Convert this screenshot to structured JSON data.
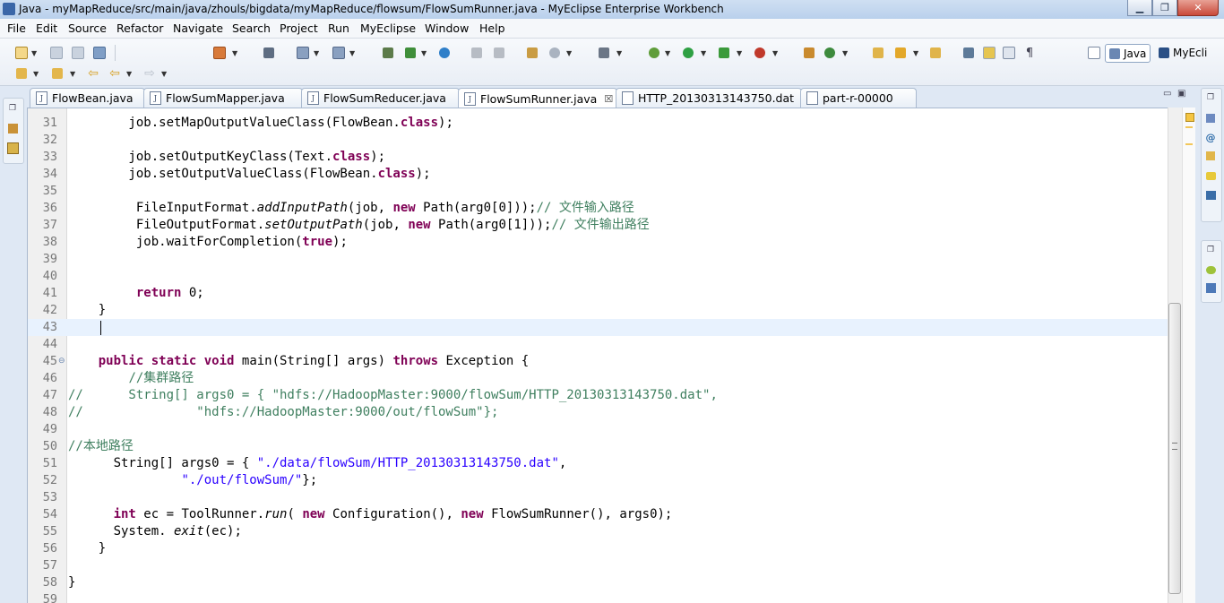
{
  "window": {
    "title": "Java - myMapReduce/src/main/java/zhouls/bigdata/myMapReduce/flowsum/FlowSumRunner.java - MyEclipse Enterprise Workbench",
    "min_glyph": "▁",
    "max_glyph": "❐",
    "close_glyph": "✕"
  },
  "menu": [
    "File",
    "Edit",
    "Source",
    "Refactor",
    "Navigate",
    "Search",
    "Project",
    "Run",
    "MyEclipse",
    "Window",
    "Help"
  ],
  "perspectives": {
    "java": "Java",
    "myeclipse": "MyEcli"
  },
  "tabs": [
    {
      "label": "FlowBean.java",
      "active": false
    },
    {
      "label": "FlowSumMapper.java",
      "active": false
    },
    {
      "label": "FlowSumReducer.java",
      "active": false
    },
    {
      "label": "FlowSumRunner.java",
      "active": true,
      "close": "☒"
    },
    {
      "label": "HTTP_20130313143750.dat",
      "active": false
    },
    {
      "label": "part-r-00000",
      "active": false
    }
  ],
  "tab_controls": {
    "minimize": "▭",
    "maximize": "▣"
  },
  "editor": {
    "current_line": 43,
    "lines": [
      {
        "n": "31",
        "tokens": [
          {
            "t": "        job.setMapOutputValueClass(FlowBean."
          },
          {
            "t": "class",
            "c": "k"
          },
          {
            "t": ");"
          }
        ]
      },
      {
        "n": "32",
        "tokens": []
      },
      {
        "n": "33",
        "tokens": [
          {
            "t": "        job.setOutputKeyClass(Text."
          },
          {
            "t": "class",
            "c": "k"
          },
          {
            "t": ");"
          }
        ]
      },
      {
        "n": "34",
        "tokens": [
          {
            "t": "        job.setOutputValueClass(FlowBean."
          },
          {
            "t": "class",
            "c": "k"
          },
          {
            "t": ");"
          }
        ]
      },
      {
        "n": "35",
        "tokens": []
      },
      {
        "n": "36",
        "tokens": [
          {
            "t": "         FileInputFormat."
          },
          {
            "t": "addInputPath",
            "c": "i"
          },
          {
            "t": "(job, "
          },
          {
            "t": "new",
            "c": "k"
          },
          {
            "t": " Path(arg0[0]));"
          },
          {
            "t": "// 文件输入路径",
            "c": "c"
          }
        ]
      },
      {
        "n": "37",
        "tokens": [
          {
            "t": "         FileOutputFormat."
          },
          {
            "t": "setOutputPath",
            "c": "i"
          },
          {
            "t": "(job, "
          },
          {
            "t": "new",
            "c": "k"
          },
          {
            "t": " Path(arg0[1]));"
          },
          {
            "t": "// 文件输出路径",
            "c": "c"
          }
        ]
      },
      {
        "n": "38",
        "tokens": [
          {
            "t": "         job.waitForCompletion("
          },
          {
            "t": "true",
            "c": "k"
          },
          {
            "t": ");"
          }
        ]
      },
      {
        "n": "39",
        "tokens": []
      },
      {
        "n": "40",
        "tokens": []
      },
      {
        "n": "41",
        "tokens": [
          {
            "t": "         "
          },
          {
            "t": "return",
            "c": "k"
          },
          {
            "t": " 0;"
          }
        ]
      },
      {
        "n": "42",
        "tokens": [
          {
            "t": "    }"
          }
        ]
      },
      {
        "n": "43",
        "tokens": []
      },
      {
        "n": "44",
        "tokens": []
      },
      {
        "n": "45",
        "fold": "⊖",
        "tokens": [
          {
            "t": "    "
          },
          {
            "t": "public",
            "c": "k"
          },
          {
            "t": " "
          },
          {
            "t": "static",
            "c": "k"
          },
          {
            "t": " "
          },
          {
            "t": "void",
            "c": "k"
          },
          {
            "t": " main(String[] args) "
          },
          {
            "t": "throws",
            "c": "k"
          },
          {
            "t": " Exception {"
          }
        ]
      },
      {
        "n": "46",
        "tokens": [
          {
            "t": "        "
          },
          {
            "t": "//集群路径",
            "c": "c"
          }
        ]
      },
      {
        "n": "47",
        "tokens": [
          {
            "t": "//      String[] args0 = { \"hdfs://HadoopMaster:9000/flowSum/HTTP_20130313143750.dat\",",
            "c": "c"
          }
        ]
      },
      {
        "n": "48",
        "tokens": [
          {
            "t": "//               \"hdfs://HadoopMaster:9000/out/flowSum\"};",
            "c": "c"
          }
        ]
      },
      {
        "n": "49",
        "tokens": []
      },
      {
        "n": "50",
        "tokens": [
          {
            "t": "//本地路径",
            "c": "c"
          }
        ]
      },
      {
        "n": "51",
        "tokens": [
          {
            "t": "      String[] args0 = { "
          },
          {
            "t": "\"./data/flowSum/HTTP_20130313143750.dat\"",
            "c": "s"
          },
          {
            "t": ","
          }
        ]
      },
      {
        "n": "52",
        "tokens": [
          {
            "t": "               "
          },
          {
            "t": "\"./out/flowSum/\"",
            "c": "s"
          },
          {
            "t": "};"
          }
        ]
      },
      {
        "n": "53",
        "tokens": []
      },
      {
        "n": "54",
        "tokens": [
          {
            "t": "      "
          },
          {
            "t": "int",
            "c": "k"
          },
          {
            "t": " ec = ToolRunner."
          },
          {
            "t": "run",
            "c": "i"
          },
          {
            "t": "( "
          },
          {
            "t": "new",
            "c": "k"
          },
          {
            "t": " Configuration(), "
          },
          {
            "t": "new",
            "c": "k"
          },
          {
            "t": " FlowSumRunner(), args0);"
          }
        ]
      },
      {
        "n": "55",
        "tokens": [
          {
            "t": "      System. "
          },
          {
            "t": "exit",
            "c": "i"
          },
          {
            "t": "(ec);"
          }
        ]
      },
      {
        "n": "56",
        "tokens": [
          {
            "t": "    }"
          }
        ]
      },
      {
        "n": "57",
        "tokens": []
      },
      {
        "n": "58",
        "tokens": [
          {
            "t": "}"
          }
        ]
      },
      {
        "n": "59",
        "tokens": []
      }
    ]
  },
  "icons": {
    "new": "new-file-icon",
    "save": "save-icon",
    "print": "print-icon",
    "debug": "debug-icon",
    "run": "run-icon",
    "search": "search-icon",
    "open-perspective": "open-perspective-icon"
  }
}
